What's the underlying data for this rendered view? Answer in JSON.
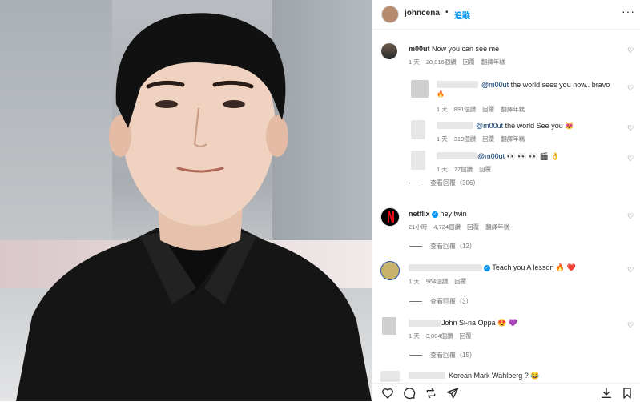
{
  "header": {
    "username": "johncena",
    "dot": "•",
    "follow": "追蹤",
    "more": "···"
  },
  "comments": [
    {
      "user": "m00ut",
      "text": "Now you can see me",
      "time": "1 天",
      "likes": "28,016個讚",
      "reply": "回覆",
      "translate": "翻譯年糕"
    },
    {
      "mention": "@m00ut",
      "text": " the world sees you now.. bravo",
      "emoji": "🔥",
      "time": "1 天",
      "likes": "891個讚",
      "reply": "回覆",
      "translate": "翻譯年糕"
    },
    {
      "mention": "@m00ut",
      "text": " the world See you",
      "emoji": "😻",
      "time": "1 天",
      "likes": "319個讚",
      "reply": "回覆",
      "translate": "翻譯年糕"
    },
    {
      "mention": "@m00ut",
      "emoji": "👀 👀 👀 🎬 👌",
      "time": "1 天",
      "likes": "77個讚",
      "reply": "回覆"
    },
    {
      "viewReplies": "查看回覆（306）"
    },
    {
      "user": "netflix",
      "text": "hey twin",
      "time": "21小時",
      "likes": "4,724個讚",
      "reply": "回覆",
      "translate": "翻譯年糕"
    },
    {
      "viewReplies": "查看回覆（12）"
    },
    {
      "text": "Teach you A lesson",
      "emoji": "🔥 ❤️",
      "time": "1 天",
      "likes": "964個讚",
      "reply": "回覆"
    },
    {
      "viewReplies": "查看回覆（3）"
    },
    {
      "text": "John Si-na Oppa",
      "emoji": "😍 💜",
      "time": "1 天",
      "likes": "3,004個讚",
      "reply": "回覆"
    },
    {
      "viewReplies": "查看回覆（15）"
    },
    {
      "text": "Korean Mark Wahlberg ?",
      "emoji": "😂"
    }
  ],
  "colors": {
    "link": "#0095f6",
    "verified": "#0095f6",
    "meta": "#737373"
  }
}
